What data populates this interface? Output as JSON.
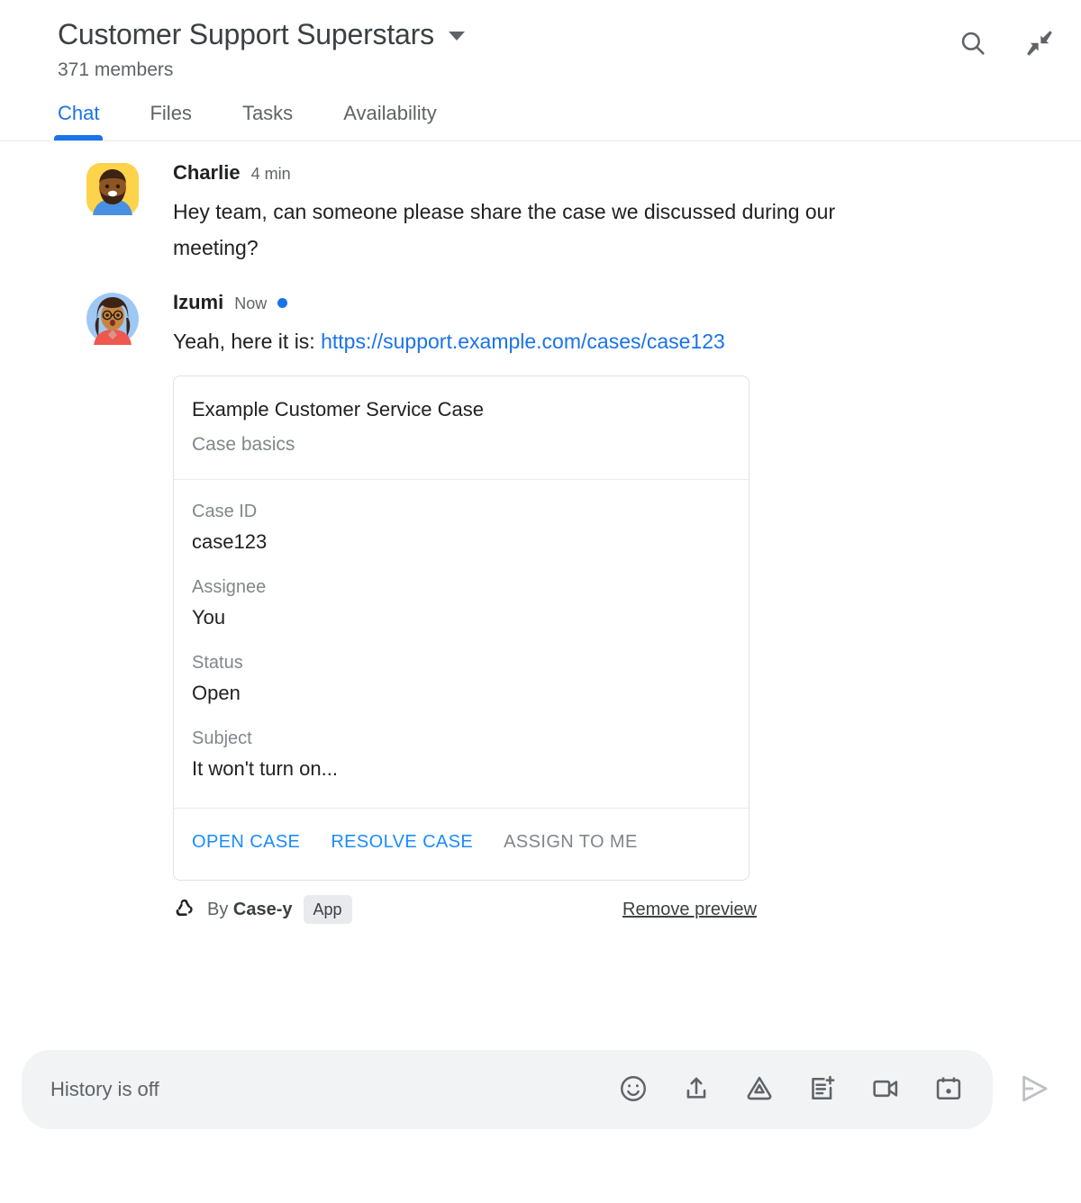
{
  "header": {
    "room_title": "Customer Support Superstars",
    "member_count": "371 members",
    "dropdown_icon": "chevron-down-icon",
    "search_icon": "search-icon",
    "collapse_icon": "collapse-arrows-icon"
  },
  "tabs": [
    {
      "label": "Chat",
      "active": true
    },
    {
      "label": "Files",
      "active": false
    },
    {
      "label": "Tasks",
      "active": false
    },
    {
      "label": "Availability",
      "active": false
    }
  ],
  "messages": [
    {
      "sender": "Charlie",
      "timestamp": "4 min",
      "unread": false,
      "text": "Hey team, can someone please share the case we discussed during our meeting?",
      "avatar": "charlie-avatar"
    },
    {
      "sender": "Izumi",
      "timestamp": "Now",
      "unread": true,
      "text_prefix": "Yeah, here it is: ",
      "link_text": "https://support.example.com/cases/case123",
      "avatar": "izumi-avatar"
    }
  ],
  "card": {
    "title": "Example Customer Service Case",
    "subtitle": "Case basics",
    "fields": [
      {
        "label": "Case ID",
        "value": "case123"
      },
      {
        "label": "Assignee",
        "value": "You"
      },
      {
        "label": "Status",
        "value": "Open"
      },
      {
        "label": "Subject",
        "value": "It won't turn on..."
      }
    ],
    "actions": [
      {
        "label": "OPEN CASE",
        "enabled": true
      },
      {
        "label": "RESOLVE CASE",
        "enabled": true
      },
      {
        "label": "ASSIGN TO ME",
        "enabled": false
      }
    ]
  },
  "card_footer": {
    "bot_icon": "webhook-icon",
    "by_prefix": "By ",
    "app_name": "Case-y",
    "app_chip": "App",
    "remove_preview": "Remove preview"
  },
  "composer": {
    "placeholder": "History is off",
    "tools": [
      {
        "icon": "emoji-icon",
        "name": "emoji-button"
      },
      {
        "icon": "upload-icon",
        "name": "upload-file-button"
      },
      {
        "icon": "google-drive-icon",
        "name": "drive-button"
      },
      {
        "icon": "add-document-icon",
        "name": "create-document-button"
      },
      {
        "icon": "video-camera-icon",
        "name": "video-meeting-button"
      },
      {
        "icon": "calendar-icon",
        "name": "calendar-button"
      }
    ],
    "send_icon": "send-icon"
  },
  "colors": {
    "accent_blue": "#1a73e8",
    "link_blue": "#1a8cff",
    "text_primary": "#202124",
    "text_secondary": "#5f6368",
    "text_tertiary": "#80868b",
    "composer_bg": "#f1f3f4",
    "border": "#e0e0e0"
  }
}
